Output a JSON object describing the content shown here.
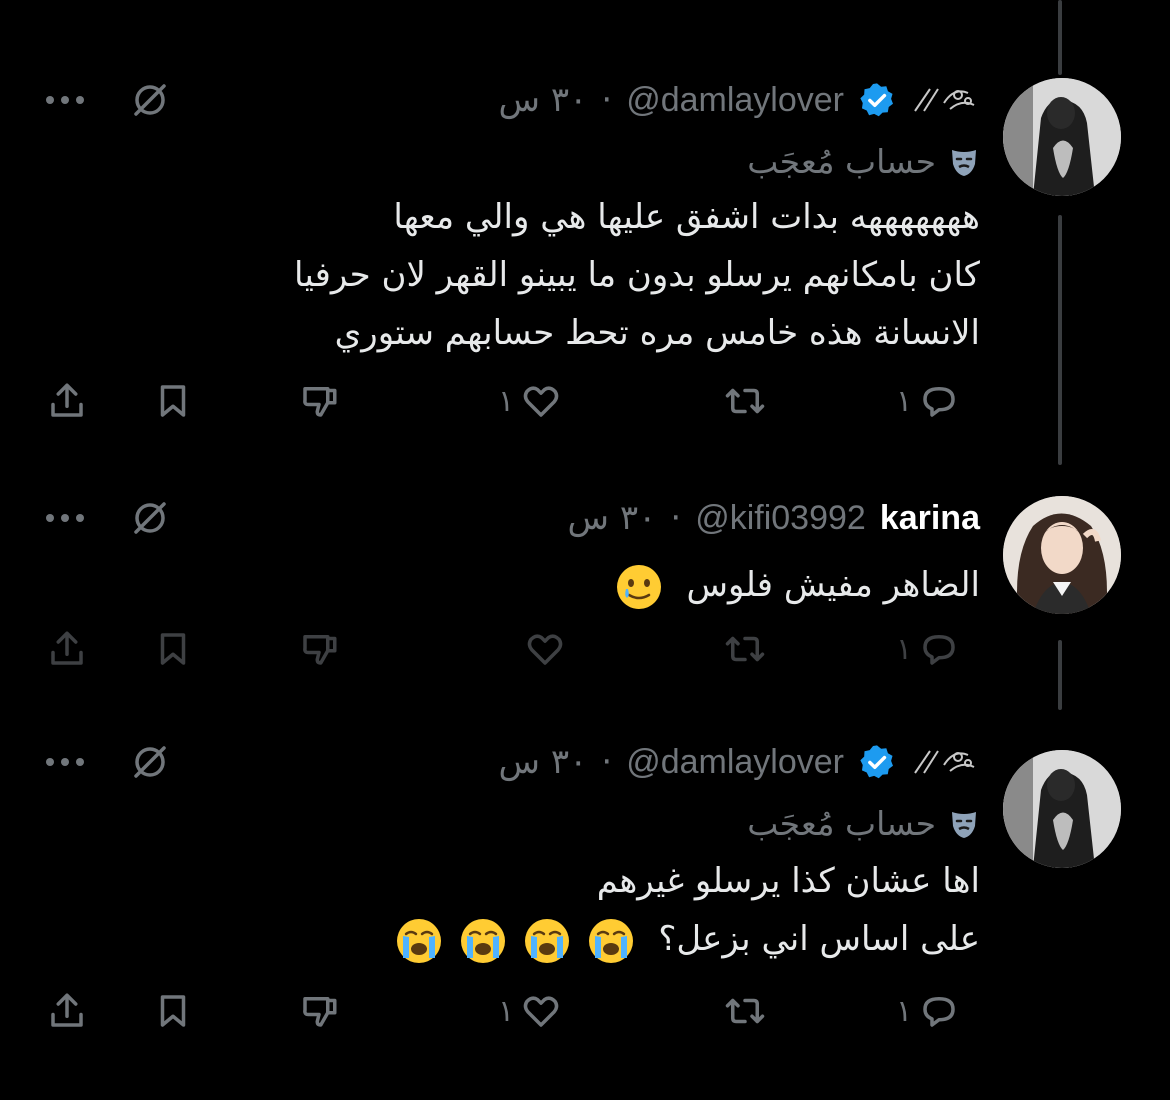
{
  "tweets": [
    {
      "display_name": "",
      "handle": "@damlaylover",
      "time": "٣٠ س",
      "verified": true,
      "label": "حساب مُعجَب",
      "lines": [
        "هههههههه بدات اشفق عليها هي والي معها",
        "كان بامكانهم يرسلو بدون ما يبينو القهر لان حرفيا",
        "الانسانة هذه خامس مره تحط حسابهم ستوري"
      ],
      "reply_count": "١",
      "like_count": "١",
      "icons": [
        "more-icon",
        "grok-icon",
        "flower-icon",
        "verified-icon",
        "mask-icon",
        "reply-icon",
        "retweet-icon",
        "like-icon",
        "dislike-icon",
        "bookmark-icon",
        "share-icon"
      ]
    },
    {
      "display_name": "karina",
      "handle": "@kifi03992",
      "time": "٣٠ س",
      "verified": false,
      "label": "",
      "lines": [
        "الضاهر مفيش فلوس"
      ],
      "reply_count": "١",
      "like_count": "",
      "icons": [
        "more-icon",
        "grok-icon",
        "crying-smile-emoji",
        "reply-icon",
        "retweet-icon",
        "like-icon",
        "dislike-icon",
        "bookmark-icon",
        "share-icon"
      ]
    },
    {
      "display_name": "",
      "handle": "@damlaylover",
      "time": "٣٠ س",
      "verified": true,
      "label": "حساب مُعجَب",
      "lines": [
        "اها عشان كذا يرسلو غيرهم",
        "على اساس اني بزعل؟"
      ],
      "reply_count": "١",
      "like_count": "١",
      "icons": [
        "more-icon",
        "grok-icon",
        "flower-icon",
        "verified-icon",
        "mask-icon",
        "loudly-crying-emoji",
        "reply-icon",
        "retweet-icon",
        "like-icon",
        "dislike-icon",
        "bookmark-icon",
        "share-icon"
      ]
    }
  ],
  "colors": {
    "background": "#000000",
    "text": "#e7e9ea",
    "muted": "#71767b",
    "verified_blue": "#1d9bf0",
    "thread_line": "#3a3d40"
  }
}
